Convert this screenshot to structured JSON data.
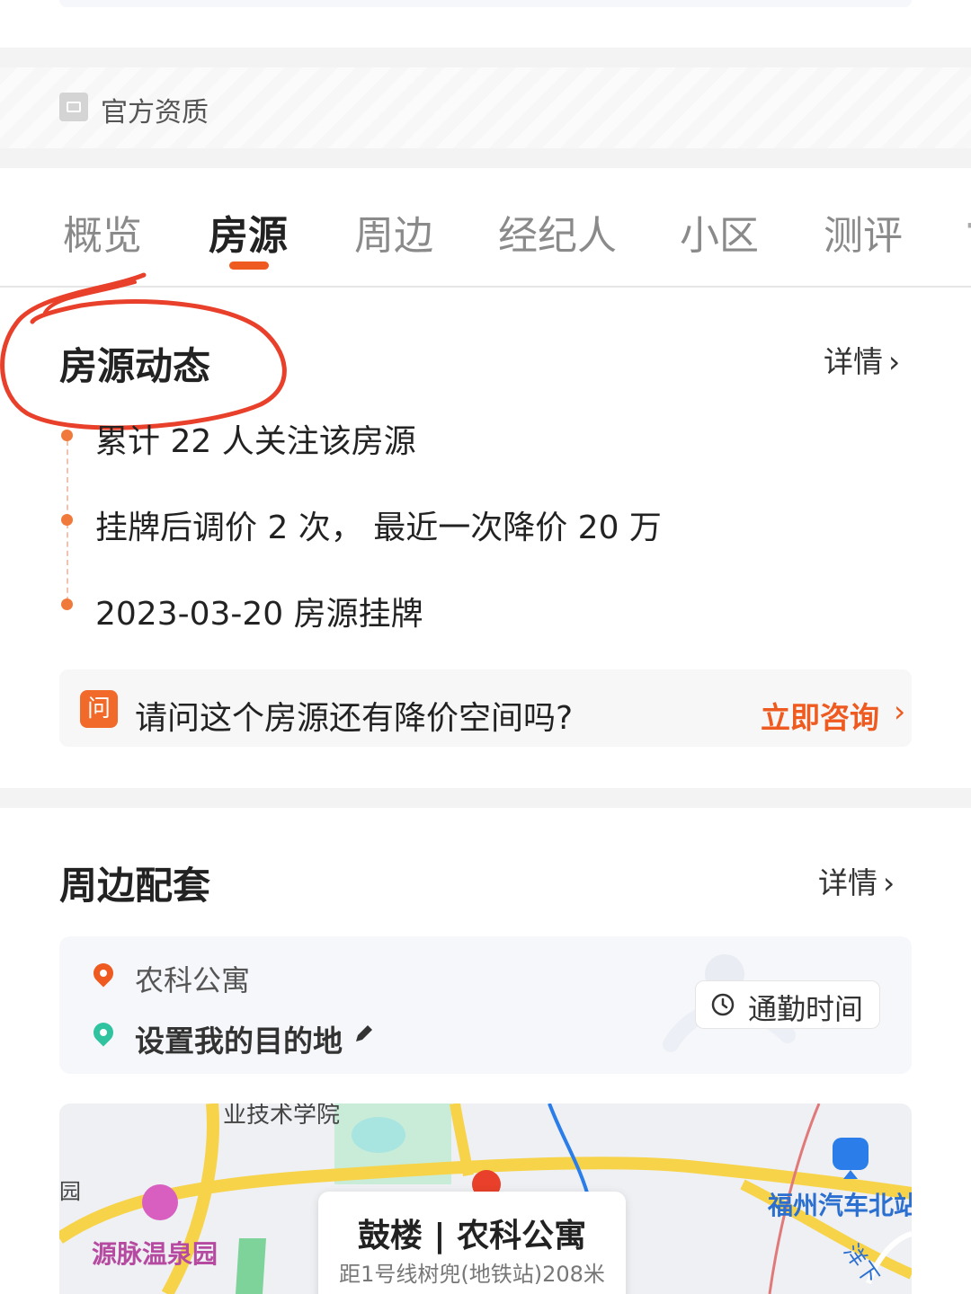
{
  "qualification": {
    "label": "官方资质"
  },
  "tabs": [
    {
      "label": "概览"
    },
    {
      "label": "房源",
      "active": true
    },
    {
      "label": "周边"
    },
    {
      "label": "经纪人"
    },
    {
      "label": "小区"
    },
    {
      "label": "测评"
    }
  ],
  "listing_activity": {
    "title": "房源动态",
    "more_label": "详情",
    "events": [
      {
        "text": "累计 22 人关注该房源"
      },
      {
        "text": "挂牌后调价 2 次，  最近一次降价 20 万"
      },
      {
        "text": "2023-03-20 房源挂牌"
      }
    ]
  },
  "question": {
    "badge": "问",
    "text": "请问这个房源还有降价空间吗?",
    "action_label": "立即咨询"
  },
  "surroundings": {
    "title": "周边配套",
    "more_label": "详情",
    "origin": "农科公寓",
    "destination_label": "设置我的目的地",
    "commute_label": "通勤时间"
  },
  "map": {
    "labels": {
      "school": "业技术学院",
      "park": "园",
      "hotspring": "源脉温泉园",
      "bus_station": "福州汽车北站",
      "road": "洋下"
    },
    "card_title": "鼓楼 | 农科公寓",
    "card_subtitle": "距1号线树兜(地铁站)208米"
  },
  "colors": {
    "accent": "#ee5a1f",
    "annotation": "#e8402a",
    "green": "#2fc3a0",
    "map_blue": "#2b7de9"
  }
}
